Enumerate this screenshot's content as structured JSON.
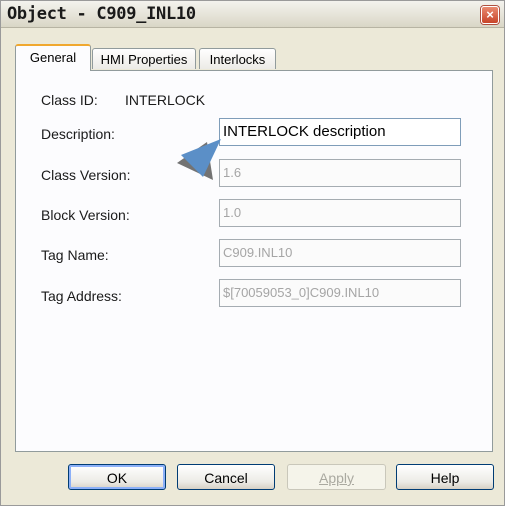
{
  "window": {
    "title": "Object - C909_INL10",
    "close_label": "×"
  },
  "tabs": [
    {
      "label": "General",
      "active": true
    },
    {
      "label": "HMI Properties",
      "active": false
    },
    {
      "label": "Interlocks",
      "active": false
    }
  ],
  "general": {
    "class_id_label": "Class ID:",
    "class_id_value": "INTERLOCK",
    "description_label": "Description:",
    "description_value": "INTERLOCK description",
    "class_version_label": "Class Version:",
    "class_version_value": "1.6",
    "block_version_label": "Block Version:",
    "block_version_value": "1.0",
    "tag_name_label": "Tag Name:",
    "tag_name_value": "C909.INL10",
    "tag_address_label": "Tag Address:",
    "tag_address_value": "$[70059053_0]C909.INL10"
  },
  "buttons": {
    "ok": "OK",
    "cancel": "Cancel",
    "apply": "Apply",
    "help": "Help"
  },
  "colors": {
    "pointer_arrow": "#5b8fc7",
    "arrow_shadow": "#5a5a5a",
    "active_tab_accent": "#f0a82f"
  }
}
